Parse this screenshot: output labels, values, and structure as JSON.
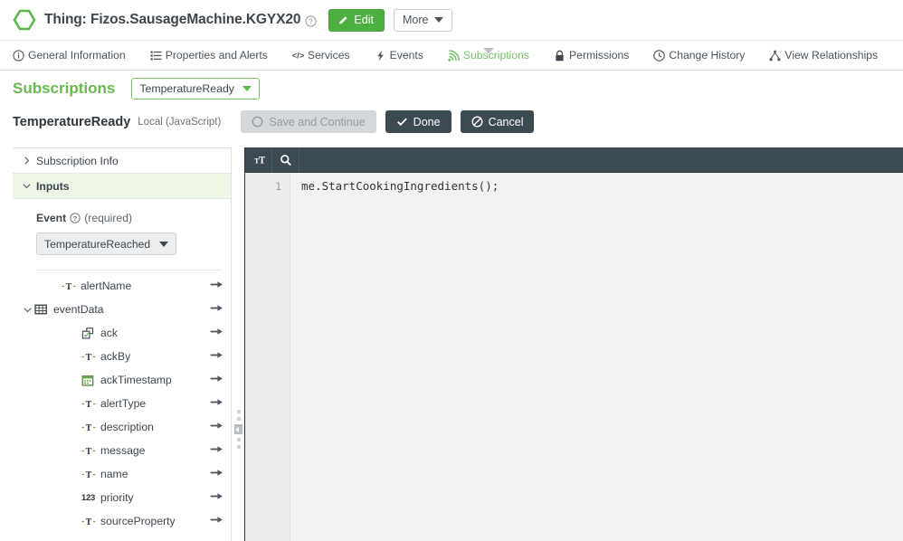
{
  "header": {
    "logo_icon": "hexagon-icon",
    "title": "Thing: Fizos.SausageMachine.KGYX20",
    "help_icon": "help-circle-icon",
    "edit_label": "Edit",
    "edit_icon": "pencil-icon",
    "more_label": "More",
    "more_caret_icon": "chevron-down-icon"
  },
  "tabs": [
    {
      "label": "General Information",
      "icon": "info-circle-icon",
      "active": false
    },
    {
      "label": "Properties and Alerts",
      "icon": "list-icon",
      "active": false
    },
    {
      "label": "Services",
      "icon": "code-brackets-icon",
      "active": false
    },
    {
      "label": "Events",
      "icon": "lightning-bolt-icon",
      "active": false
    },
    {
      "label": "Subscriptions",
      "icon": "signal-waves-icon",
      "active": true
    },
    {
      "label": "Permissions",
      "icon": "lock-icon",
      "active": false
    },
    {
      "label": "Change History",
      "icon": "clock-icon",
      "active": false
    },
    {
      "label": "View Relationships",
      "icon": "hierarchy-icon",
      "active": false
    }
  ],
  "subscriptions_bar": {
    "title": "Subscriptions",
    "selected": "TemperatureReady",
    "caret_icon": "chevron-down-icon"
  },
  "action_bar": {
    "name": "TemperatureReady",
    "subtitle": "Local (JavaScript)",
    "save_label": "Save and Continue",
    "save_icon": "circle-icon",
    "save_disabled": true,
    "done_label": "Done",
    "done_icon": "check-icon",
    "cancel_label": "Cancel",
    "cancel_icon": "no-entry-icon"
  },
  "sidebar": {
    "sections": [
      {
        "label": "Subscription Info",
        "expanded": false,
        "chevron": "chevron-right-icon"
      },
      {
        "label": "Inputs",
        "expanded": true,
        "chevron": "chevron-down-icon"
      }
    ],
    "event_field": {
      "label": "Event",
      "help_icon": "help-circle-icon",
      "required_text": "(required)",
      "value": "TemperatureReached",
      "caret_icon": "chevron-down-icon"
    },
    "tree": [
      {
        "label": "alertName",
        "icon": "string-type-icon",
        "indent": 1,
        "chevron": "",
        "arrow": "arrow-right-icon"
      },
      {
        "label": "eventData",
        "icon": "infotable-type-icon",
        "indent": 0,
        "chevron": "chevron-down-icon",
        "arrow": "arrow-right-icon"
      },
      {
        "label": "ack",
        "icon": "boolean-type-icon",
        "indent": 2,
        "chevron": "",
        "arrow": "arrow-right-icon"
      },
      {
        "label": "ackBy",
        "icon": "string-type-icon",
        "indent": 2,
        "chevron": "",
        "arrow": "arrow-right-icon"
      },
      {
        "label": "ackTimestamp",
        "icon": "datetime-type-icon",
        "indent": 2,
        "chevron": "",
        "arrow": "arrow-right-icon"
      },
      {
        "label": "alertType",
        "icon": "string-type-icon",
        "indent": 2,
        "chevron": "",
        "arrow": "arrow-right-icon"
      },
      {
        "label": "description",
        "icon": "string-type-icon",
        "indent": 2,
        "chevron": "",
        "arrow": "arrow-right-icon"
      },
      {
        "label": "message",
        "icon": "string-type-icon",
        "indent": 2,
        "chevron": "",
        "arrow": "arrow-right-icon"
      },
      {
        "label": "name",
        "icon": "string-type-icon",
        "indent": 2,
        "chevron": "",
        "arrow": "arrow-right-icon"
      },
      {
        "label": "priority",
        "icon": "number-type-icon",
        "indent": 2,
        "chevron": "",
        "arrow": "arrow-right-icon"
      },
      {
        "label": "sourceProperty",
        "icon": "string-type-icon",
        "indent": 2,
        "chevron": "",
        "arrow": "arrow-right-icon"
      }
    ]
  },
  "editor": {
    "toolbar": [
      {
        "icon": "text-size-icon"
      },
      {
        "icon": "search-icon"
      }
    ],
    "lines": [
      {
        "number": "1",
        "text": "me.StartCookingIngredients();"
      }
    ],
    "code": "me.StartCookingIngredients();",
    "line_number": "1"
  },
  "colors": {
    "brand_green": "#4caf3f",
    "tab_active_green": "#76c068",
    "heading_green": "#6ab84f",
    "dark_slate": "#3c4a51",
    "disabled_gray": "#d5d8da",
    "section_highlight": "#eef6e8"
  }
}
